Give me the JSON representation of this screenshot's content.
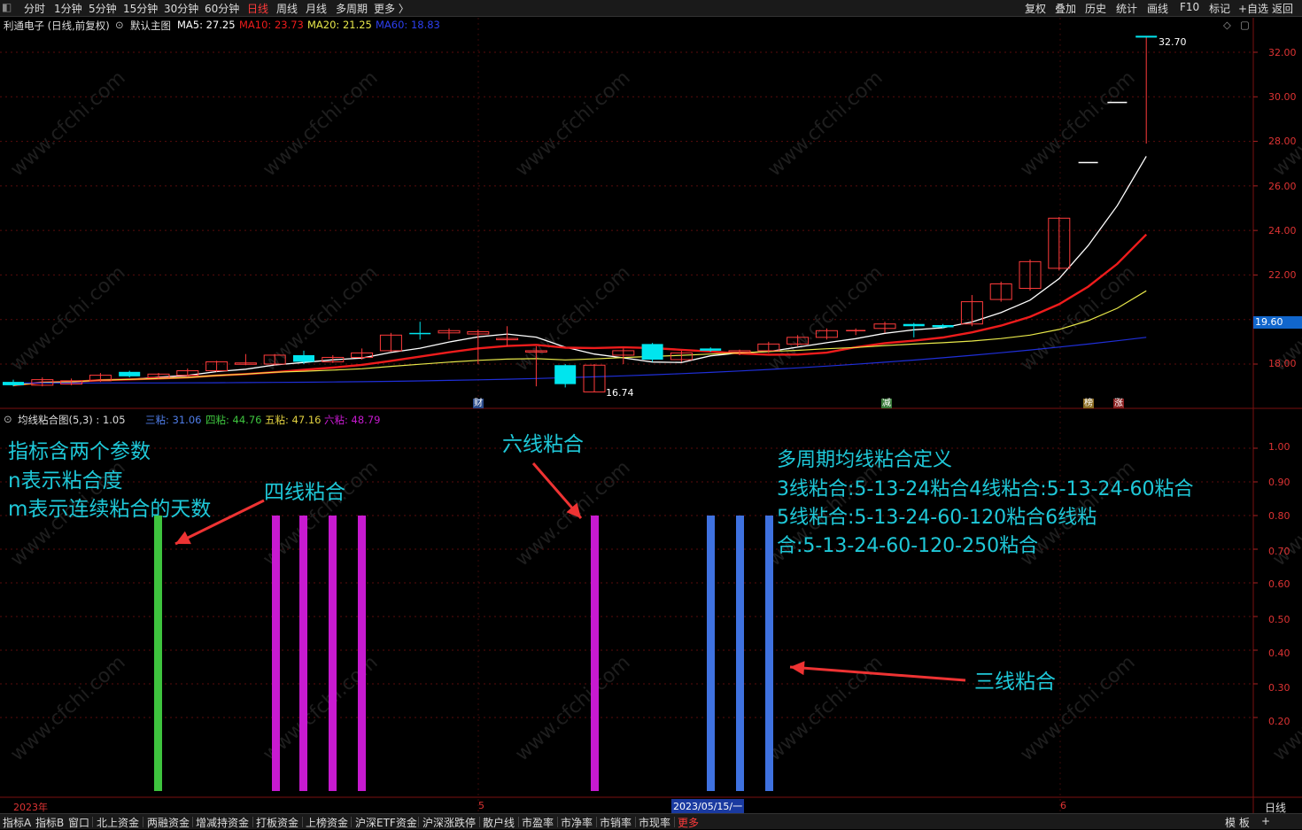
{
  "topbar": {
    "periods": [
      "分时",
      "1分钟",
      "5分钟",
      "15分钟",
      "30分钟",
      "60分钟",
      "日线",
      "周线",
      "月线",
      "多周期",
      "更多 〉"
    ],
    "active_period": "日线",
    "right_buttons": [
      "复权",
      "叠加",
      "历史",
      "统计",
      "画线",
      "F10",
      "标记",
      "+自选",
      "返回"
    ]
  },
  "main_legend": {
    "stock": "利通电子 (日线,前复权)",
    "chart_name": "默认主图",
    "ma5": "MA5: 27.25",
    "ma10": "MA10: 23.73",
    "ma20": "MA20: 21.25",
    "ma60": "MA60: 18.83"
  },
  "indicator_legend": {
    "name": "均线粘合图(5,3) : 1.05",
    "three": "三粘: 31.06",
    "four": "四粘: 44.76",
    "five": "五粘: 47.16",
    "six": "六粘: 48.79"
  },
  "colors": {
    "bg": "#000000",
    "up": "#ff3b3b",
    "down": "#00e5ee",
    "ma5": "#ffffff",
    "ma10": "#ee1c1c",
    "ma20": "#e8e84a",
    "ma60": "#1f2fd8",
    "green_bar": "#3ec43e",
    "purple_bar": "#c71ad0",
    "blue_bar": "#3f72e0",
    "annotation": "#1fc8d8",
    "arrow": "#ee3333"
  },
  "price_axis": [
    "32.00",
    "30.00",
    "28.00",
    "26.00",
    "24.00",
    "22.00",
    "20.00",
    "18.00"
  ],
  "current_price": "19.60",
  "high_label": "32.70",
  "low_label": "16.74",
  "indicator_axis": [
    "1.00",
    "0.90",
    "0.80",
    "0.70",
    "0.60",
    "0.50",
    "0.40",
    "0.30",
    "0.20"
  ],
  "event_marks": [
    "财",
    "减",
    "榜",
    "涨"
  ],
  "date_axis": {
    "year": "2023年",
    "may": "5",
    "june": "6",
    "cursor_date": "2023/05/15/一",
    "period": "日线"
  },
  "annotations": {
    "params_line1": "指标含两个参数",
    "params_line2": "n表示粘合度",
    "params_line3": "m表示连续粘合的天数",
    "four_line": "四线粘合",
    "six_line": "六线粘合",
    "three_line": "三线粘合",
    "definition_title": "多周期均线粘合定义",
    "definition_1": "3线粘合:5-13-24粘合4线粘合:5-13-24-60粘合",
    "definition_2": "5线粘合:5-13-24-60-120粘合6线粘",
    "definition_3": "合:5-13-24-60-120-250粘合"
  },
  "bottombar": {
    "tabs": [
      "指标A",
      "指标B",
      "窗口",
      "北上资金",
      "两融资金",
      "增减持资金",
      "打板资金",
      "上榜资金",
      "沪深ETF资金",
      "沪深涨跌停",
      "散户线",
      "市盈率",
      "市净率",
      "市销率",
      "市现率",
      "更多"
    ],
    "active_tab": "更多",
    "right": [
      "模 板",
      "+"
    ]
  },
  "chart_data": {
    "type": "candlestick",
    "title": "利通电子 (日线,前复权)",
    "y_range": [
      16.5,
      33.2
    ],
    "candles": [
      {
        "o": 17.2,
        "c": 17.05,
        "h": 17.3,
        "l": 17.0
      },
      {
        "o": 17.05,
        "c": 17.3,
        "h": 17.4,
        "l": 17.0
      },
      {
        "o": 17.1,
        "c": 17.25,
        "h": 17.35,
        "l": 17.05
      },
      {
        "o": 17.25,
        "c": 17.5,
        "h": 17.6,
        "l": 17.2
      },
      {
        "o": 17.65,
        "c": 17.45,
        "h": 17.7,
        "l": 17.4
      },
      {
        "o": 17.4,
        "c": 17.55,
        "h": 17.6,
        "l": 17.35
      },
      {
        "o": 17.5,
        "c": 17.7,
        "h": 17.8,
        "l": 17.45
      },
      {
        "o": 17.7,
        "c": 18.1,
        "h": 18.15,
        "l": 17.65
      },
      {
        "o": 18.0,
        "c": 18.05,
        "h": 18.45,
        "l": 17.95
      },
      {
        "o": 18.0,
        "c": 18.4,
        "h": 18.45,
        "l": 17.95
      },
      {
        "o": 18.4,
        "c": 18.1,
        "h": 18.6,
        "l": 18.0
      },
      {
        "o": 18.1,
        "c": 18.3,
        "h": 18.4,
        "l": 18.05
      },
      {
        "o": 18.3,
        "c": 18.5,
        "h": 18.7,
        "l": 18.2
      },
      {
        "o": 18.6,
        "c": 19.3,
        "h": 19.4,
        "l": 18.55
      },
      {
        "o": 19.4,
        "c": 19.35,
        "h": 19.9,
        "l": 19.1
      },
      {
        "o": 19.4,
        "c": 19.5,
        "h": 19.6,
        "l": 19.1
      },
      {
        "o": 19.35,
        "c": 19.45,
        "h": 19.55,
        "l": 18.0
      },
      {
        "o": 19.1,
        "c": 19.15,
        "h": 19.7,
        "l": 18.8
      },
      {
        "o": 18.55,
        "c": 18.6,
        "h": 18.8,
        "l": 17.0
      },
      {
        "o": 17.95,
        "c": 17.1,
        "h": 18.0,
        "l": 16.95
      },
      {
        "o": 16.75,
        "c": 17.95,
        "h": 18.0,
        "l": 16.74
      },
      {
        "o": 18.4,
        "c": 18.6,
        "h": 18.7,
        "l": 18.0
      },
      {
        "o": 18.9,
        "c": 18.2,
        "h": 18.95,
        "l": 18.1
      },
      {
        "o": 18.2,
        "c": 18.5,
        "h": 18.6,
        "l": 18.1
      },
      {
        "o": 18.7,
        "c": 18.6,
        "h": 18.75,
        "l": 18.55
      },
      {
        "o": 18.55,
        "c": 18.6,
        "h": 18.65,
        "l": 18.4
      },
      {
        "o": 18.6,
        "c": 18.9,
        "h": 19.0,
        "l": 18.5
      },
      {
        "o": 18.9,
        "c": 19.2,
        "h": 19.3,
        "l": 18.8
      },
      {
        "o": 19.2,
        "c": 19.5,
        "h": 19.6,
        "l": 19.1
      },
      {
        "o": 19.5,
        "c": 19.5,
        "h": 19.6,
        "l": 19.3
      },
      {
        "o": 19.6,
        "c": 19.8,
        "h": 19.9,
        "l": 19.4
      },
      {
        "o": 19.8,
        "c": 19.7,
        "h": 19.85,
        "l": 19.2
      },
      {
        "o": 19.75,
        "c": 19.65,
        "h": 19.8,
        "l": 19.6
      },
      {
        "o": 19.8,
        "c": 20.8,
        "h": 21.1,
        "l": 19.7
      },
      {
        "o": 20.9,
        "c": 21.6,
        "h": 21.7,
        "l": 20.8
      },
      {
        "o": 21.4,
        "c": 22.6,
        "h": 22.7,
        "l": 21.3
      },
      {
        "o": 22.3,
        "c": 24.55,
        "h": 24.6,
        "l": 22.2
      },
      {
        "o": 27.05,
        "c": 27.05,
        "h": 27.05,
        "l": 27.05
      },
      {
        "o": 29.75,
        "c": 29.75,
        "h": 29.75,
        "l": 29.75
      },
      {
        "o": 32.7,
        "c": 32.7,
        "h": 32.7,
        "l": 27.9
      }
    ],
    "ma_series": [
      "MA5",
      "MA10",
      "MA20",
      "MA60"
    ],
    "indicator": {
      "name": "均线粘合图(5,3)",
      "bars": [
        {
          "idx": 5,
          "value": 0.8,
          "type": "四粘"
        },
        {
          "idx": 9,
          "value": 0.8,
          "type": "六粘"
        },
        {
          "idx": 10,
          "value": 0.8,
          "type": "六粘"
        },
        {
          "idx": 11,
          "value": 0.8,
          "type": "六粘"
        },
        {
          "idx": 12,
          "value": 0.8,
          "type": "六粘"
        },
        {
          "idx": 20,
          "value": 0.8,
          "type": "六粘"
        },
        {
          "idx": 24,
          "value": 0.8,
          "type": "三粘"
        },
        {
          "idx": 25,
          "value": 0.8,
          "type": "三粘"
        },
        {
          "idx": 26,
          "value": 0.8,
          "type": "三粘"
        }
      ]
    }
  }
}
